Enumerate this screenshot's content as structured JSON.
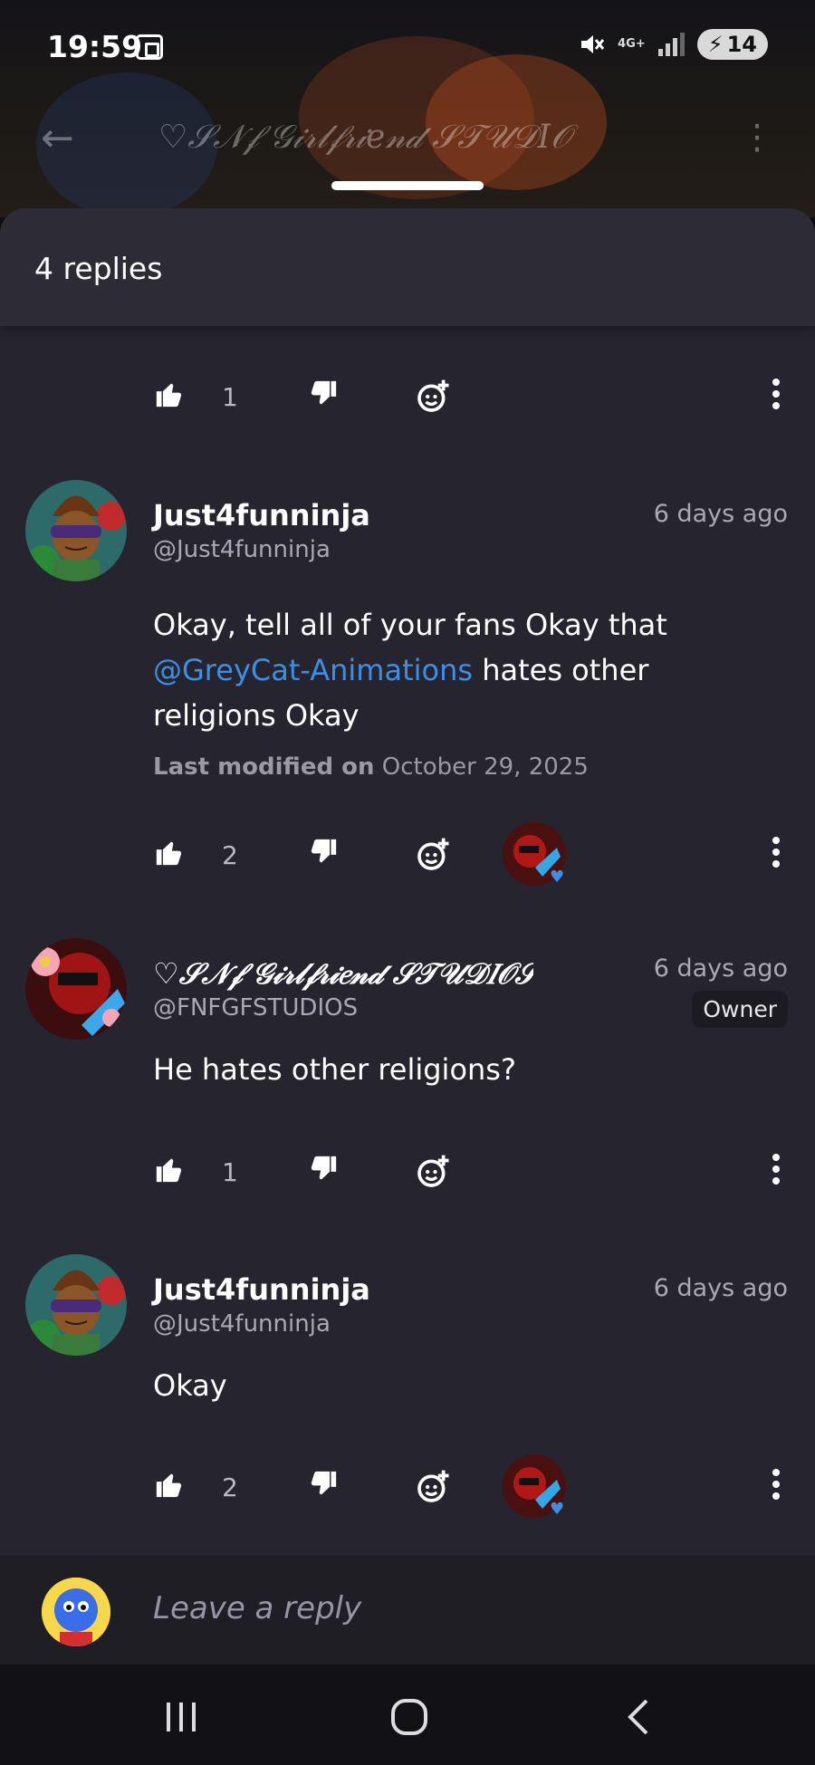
{
  "status_bar": {
    "time": "19:59",
    "network": "4G+",
    "battery": "14"
  },
  "app_bar": {
    "title": "♡𝒮𝒩𝒻 𝒢𝒾𝓇𝓁𝒻𝓇𝒾𝑒𝓃𝒹 𝒮𝒯𝒰𝒟𝐼𝒪"
  },
  "sheet": {
    "title": "4 replies",
    "top_actions": {
      "like_count": "1"
    }
  },
  "comments": [
    {
      "username": "Just4funninja",
      "handle": "@Just4funninja",
      "time": "6 days ago",
      "text_before": "Okay, tell all of your fans Okay that ",
      "mention": "@GreyCat-Animations",
      "text_after": " hates other religions Okay",
      "modified_label": "Last modified on",
      "modified_date": "October 29, 2025",
      "like_count": "2"
    },
    {
      "username": "♡𝒮𝒩𝒻 𝒢𝒾𝓇𝓁𝒻𝓇𝒾𝑒𝓃𝒹 𝒮𝒯𝒰𝒟𝐼𝒪𝒮♡ (Mu",
      "handle": "@FNFGFSTUDIOS",
      "time": "6 days ago",
      "badge": "Owner",
      "text": "He hates other religions?",
      "like_count": "1"
    },
    {
      "username": "Just4funninja",
      "handle": "@Just4funninja",
      "time": "6 days ago",
      "text": "Okay",
      "like_count": "2"
    }
  ],
  "reply_bar": {
    "placeholder": "Leave a reply"
  },
  "colors": {
    "sheet_bg": "#26252f",
    "mention": "#3d8ee5",
    "muted_text": "#a9a8b5"
  }
}
